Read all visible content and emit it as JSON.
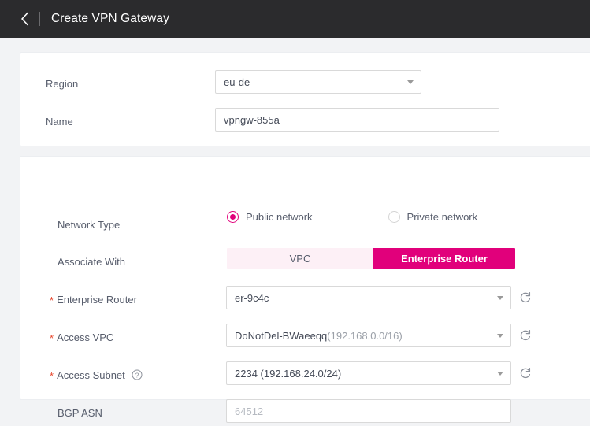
{
  "header": {
    "back_icon": "chevron-left-icon",
    "title": "Create VPN Gateway"
  },
  "theme": {
    "accent": "#e1007b",
    "accent_light": "#fdf0f6",
    "required_asterisk": "#e6452b",
    "header_bg": "#2b2b2d",
    "page_bg": "#f2f3f5"
  },
  "basic_card": {
    "region": {
      "label": "Region",
      "value": "eu-de",
      "caret_icon": "chevron-down-icon"
    },
    "name": {
      "label": "Name",
      "value": "vpngw-855a"
    }
  },
  "network_card": {
    "network_type": {
      "label": "Network Type",
      "options": [
        {
          "label": "Public network",
          "selected": true
        },
        {
          "label": "Private network",
          "selected": false
        }
      ]
    },
    "associate_with": {
      "label": "Associate With",
      "options": [
        {
          "label": "VPC",
          "selected": false
        },
        {
          "label": "Enterprise Router",
          "selected": true
        }
      ]
    },
    "enterprise_router": {
      "label": "Enterprise Router",
      "required": "*",
      "value": "er-9c4c",
      "caret_icon": "chevron-down-icon",
      "refresh_icon": "refresh-icon"
    },
    "access_vpc": {
      "label": "Access VPC",
      "required": "*",
      "value_name": "DoNotDel-BWaeeqq",
      "value_cidr": "(192.168.0.0/16)",
      "caret_icon": "chevron-down-icon",
      "refresh_icon": "refresh-icon"
    },
    "access_subnet": {
      "label": "Access Subnet",
      "required": "*",
      "help_icon": "help-circle-icon",
      "value": "2234 (192.168.24.0/24)",
      "caret_icon": "chevron-down-icon",
      "refresh_icon": "refresh-icon"
    },
    "bgp_asn": {
      "label": "BGP ASN",
      "placeholder": "64512",
      "value": ""
    }
  }
}
